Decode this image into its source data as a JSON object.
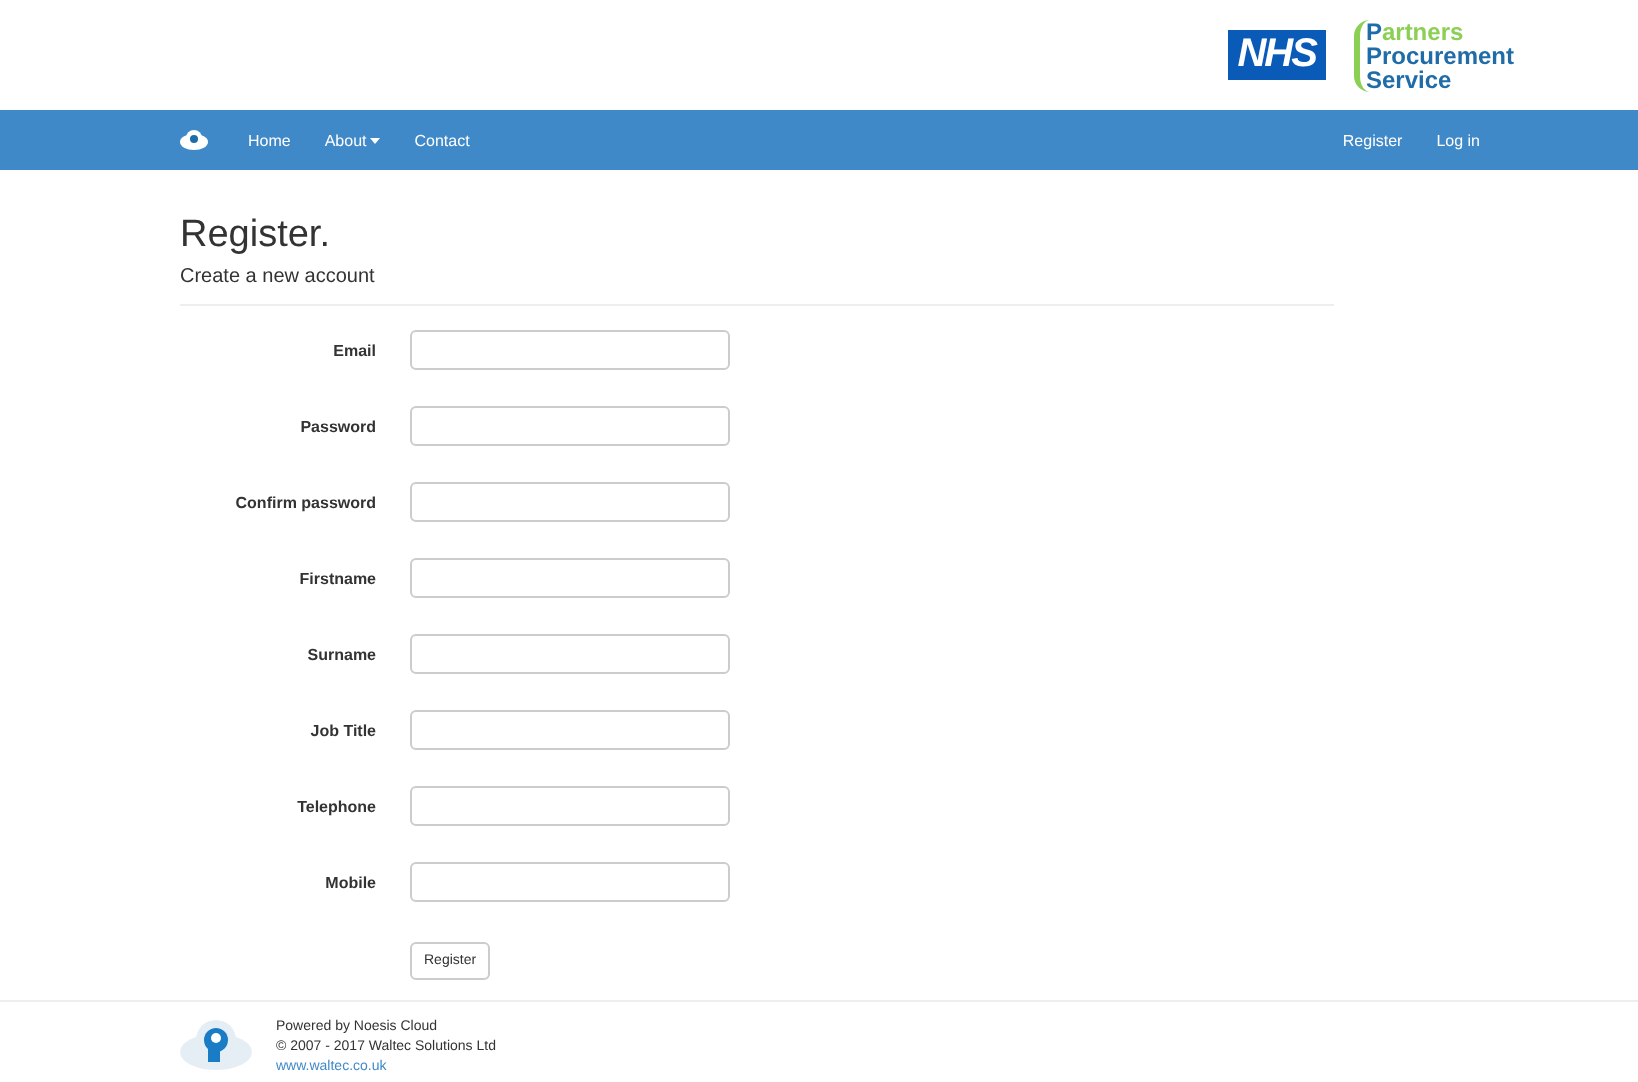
{
  "header": {
    "nhs_logo": "NHS",
    "brand_lines": [
      "Partners",
      "Procurement",
      "Service"
    ]
  },
  "navbar": {
    "left": [
      {
        "label": "Home",
        "dropdown": false
      },
      {
        "label": "About",
        "dropdown": true
      },
      {
        "label": "Contact",
        "dropdown": false
      }
    ],
    "right": [
      "Register",
      "Log in"
    ]
  },
  "page": {
    "title": "Register.",
    "subtitle": "Create a new account"
  },
  "form": {
    "fields": [
      {
        "label": "Email"
      },
      {
        "label": "Password"
      },
      {
        "label": "Confirm password"
      },
      {
        "label": "Firstname"
      },
      {
        "label": "Surname"
      },
      {
        "label": "Job Title"
      },
      {
        "label": "Telephone"
      },
      {
        "label": "Mobile"
      }
    ],
    "submit": "Register"
  },
  "footer": {
    "lines": [
      "Powered by Noesis Cloud",
      "© 2007 - 2017 Waltec Solutions Ltd"
    ],
    "link": "www.waltec.co.uk"
  }
}
